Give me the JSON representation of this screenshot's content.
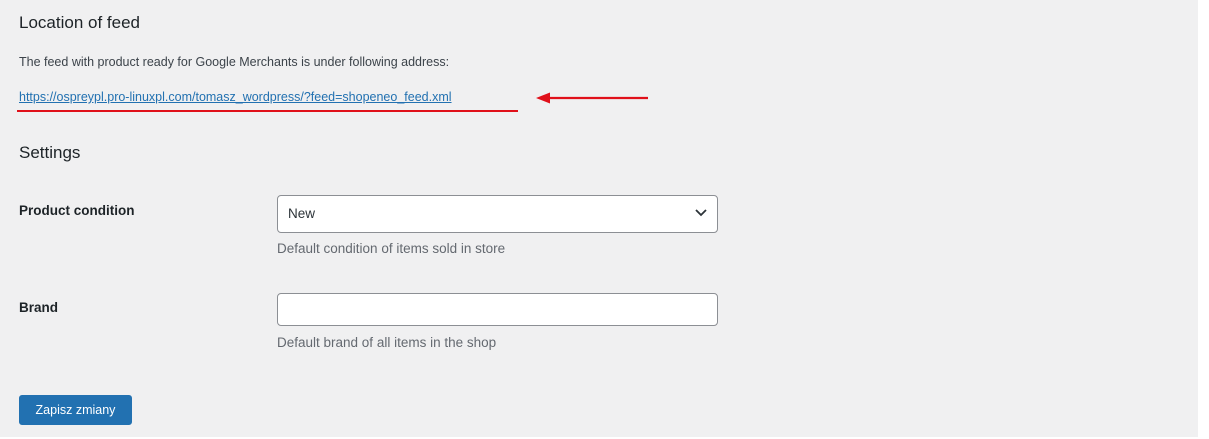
{
  "location": {
    "title": "Location of feed",
    "description": "The feed with product ready for Google Merchants is under following address:",
    "feed_url": "https://ospreypl.pro-linuxpl.com/tomasz_wordpress/?feed=shopeneo_feed.xml"
  },
  "settings": {
    "title": "Settings",
    "product_condition": {
      "label": "Product condition",
      "selected": "New",
      "help": "Default condition of items sold in store"
    },
    "brand": {
      "label": "Brand",
      "value": "",
      "help": "Default brand of all items in the shop"
    }
  },
  "save_button": "Zapisz zmiany",
  "colors": {
    "accent": "#2271b1",
    "annotation": "#e0101a",
    "panel_bg": "#f0f0f1"
  },
  "icons": {
    "select_arrow": "chevron-down-icon",
    "annotation": "red-arrow-icon"
  }
}
